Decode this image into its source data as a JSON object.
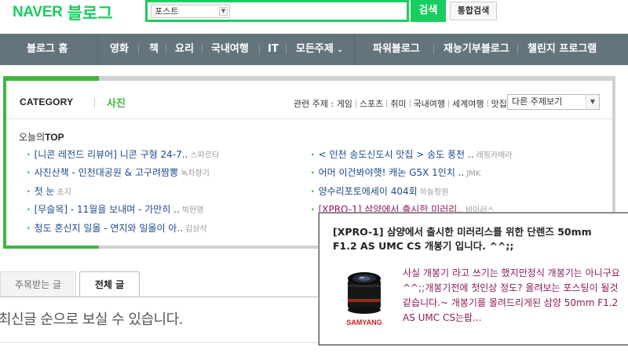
{
  "header": {
    "logo_naver": "NAVER",
    "logo_blog": "블로그",
    "search_select_value": "포스트",
    "search_button": "검색",
    "search_all_button": "통합검색",
    "accent_color": "#19ce60"
  },
  "nav": {
    "home": "블로그 홈",
    "items": [
      "영화",
      "책",
      "요리",
      "국내여행",
      "IT",
      "모든주제"
    ],
    "right": [
      "파워블로그",
      "재능기부블로그",
      "챌린지 프로그램"
    ]
  },
  "category": {
    "label": "CATEGORY",
    "name": "사진",
    "related_label": "관련 주제 :",
    "related": [
      "게임",
      "스포츠",
      "취미",
      "국내여행",
      "세계여행",
      "맛집"
    ],
    "other_select": "다른 주제보기",
    "top_title_prefix": "오늘의",
    "top_title_bold": "TOP",
    "left_posts": [
      {
        "title": "[니콘 레전드 리뷰어] 니콘 구형 24-7..",
        "author": "스파르타"
      },
      {
        "title": "사진산책 - 인천대공원 & 고구려짬뽕",
        "author": "녹차향기"
      },
      {
        "title": "첫 눈",
        "author": "초지"
      },
      {
        "title": "[무슬목] - 11월을 보내며 - 가만히 ..",
        "author": "박현영"
      },
      {
        "title": "청도 혼신지 일몰 - 연지와 일몰이 아..",
        "author": "김상석"
      }
    ],
    "right_posts": [
      {
        "title": "< 인천 송도신도시 맛집 > 송도 풍천 ..",
        "author": "레핑카메라"
      },
      {
        "title": "어머 이건봐야햇! 캐논 G5X 1인치 ..",
        "author": "JMK"
      },
      {
        "title": "양수리포토에세이 404회",
        "author": "하늘정원"
      },
      {
        "title": "[XPRO-1] 삼양에서 출시한 미러리..",
        "author": "비이러스"
      }
    ]
  },
  "tabs": {
    "featured": "주목받는 글",
    "all": "전체 글"
  },
  "hint": "최신글 순으로 보실 수 있습니다.",
  "popup": {
    "title": "[XPRO-1] 삼양에서 출시한 미러리스를 위한 단렌즈 50mm F1.2 AS UMC CS 개봉기 입니다. ^^;;",
    "description": "사실 개봉기 라고 쓰기는 했지만정식 개봉기는 아니구요 ^^;;개봉기전에 첫인상 정도? 올려보는 포스팅이 될것 같습니다.~ 개봉기를 올려드리게된 삼양 50mm F1.2 AS UMC CS는팝...",
    "brand": "SAMYANG"
  }
}
